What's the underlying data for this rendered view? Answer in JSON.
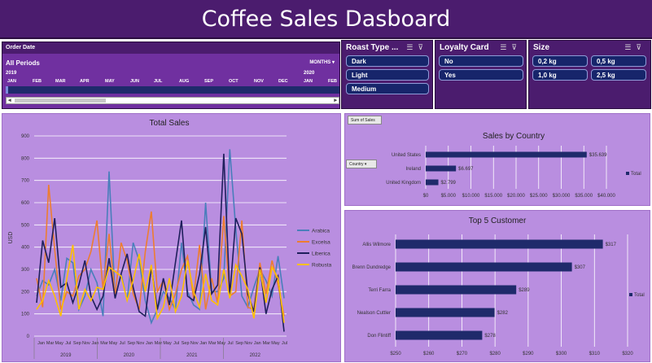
{
  "dashboard": {
    "title": "Coffee Sales Dasboard"
  },
  "timeline": {
    "header": "Order Date",
    "period": "All Periods",
    "granularity": "MONTHS",
    "years": [
      "2019",
      "2020"
    ],
    "months": [
      "JAN",
      "FEB",
      "MAR",
      "APR",
      "MAY",
      "JUN",
      "JUL",
      "AUG",
      "SEP",
      "OCT",
      "NOV",
      "DEC",
      "JAN",
      "FEB"
    ]
  },
  "slicers": {
    "roast": {
      "title": "Roast Type ...",
      "items": [
        "Dark",
        "Light",
        "Medium"
      ]
    },
    "loyalty": {
      "title": "Loyalty Card",
      "items": [
        "No",
        "Yes"
      ]
    },
    "size": {
      "title": "Size",
      "items": [
        "0,2 kg",
        "0,5 kg",
        "1,0 kg",
        "2,5 kg"
      ]
    }
  },
  "icons": {
    "multi_select": "multi-select-icon",
    "clear_filter": "clear-filter-icon"
  },
  "colors": {
    "title_bar": "#4b1c6e",
    "panel": "#b98ee0",
    "bar": "#17256b",
    "arabica": "#4a7ebb",
    "excelsa": "#ed7d31",
    "liberica": "#1f1f5c",
    "robusta": "#ffc000"
  },
  "pivot_buttons": {
    "sum_of_sales": "Sum of Sales",
    "country_field": "Country"
  },
  "chart_data": [
    {
      "type": "line",
      "title": "Total Sales",
      "ylabel": "USD",
      "ylim": [
        0,
        900
      ],
      "yticks": [
        0,
        100,
        200,
        300,
        400,
        500,
        600,
        700,
        800,
        900
      ],
      "x_month_labels": [
        "Jan",
        "Mar",
        "May",
        "Jul",
        "Sep",
        "Nov"
      ],
      "x_year_labels": [
        "2019",
        "2020",
        "2021",
        "2022"
      ],
      "grid": true,
      "legend_position": "right",
      "series": [
        {
          "name": "Arabica",
          "color": "#4a7ebb",
          "values": [
            180,
            250,
            230,
            300,
            160,
            350,
            330,
            120,
            180,
            300,
            240,
            90,
            740,
            170,
            280,
            160,
            420,
            340,
            160,
            60,
            120,
            200,
            170,
            120,
            420,
            200,
            140,
            120,
            600,
            200,
            200,
            260,
            840,
            480,
            180,
            130,
            220,
            300,
            250,
            180,
            360,
            170
          ]
        },
        {
          "name": "Excelsa",
          "color": "#ed7d31",
          "values": [
            260,
            130,
            680,
            390,
            120,
            200,
            180,
            270,
            300,
            380,
            520,
            210,
            460,
            180,
            420,
            340,
            190,
            120,
            380,
            560,
            200,
            250,
            120,
            190,
            300,
            360,
            170,
            410,
            120,
            260,
            150,
            540,
            180,
            200,
            520,
            130,
            120,
            330,
            190,
            340,
            230,
            90
          ]
        },
        {
          "name": "Liberica",
          "color": "#1f1f5c",
          "values": [
            150,
            430,
            330,
            530,
            220,
            240,
            150,
            230,
            340,
            180,
            120,
            180,
            350,
            170,
            280,
            370,
            220,
            110,
            90,
            310,
            120,
            260,
            140,
            330,
            520,
            180,
            160,
            280,
            490,
            190,
            230,
            820,
            180,
            530,
            460,
            190,
            110,
            310,
            100,
            210,
            270,
            20
          ]
        },
        {
          "name": "Robusta",
          "color": "#ffc000",
          "values": [
            120,
            160,
            250,
            180,
            90,
            260,
            410,
            120,
            210,
            160,
            220,
            210,
            310,
            290,
            270,
            160,
            250,
            370,
            200,
            320,
            80,
            130,
            260,
            110,
            180,
            340,
            200,
            130,
            280,
            160,
            140,
            300,
            170,
            320,
            270,
            210,
            80,
            300,
            150,
            310,
            260,
            60
          ]
        }
      ]
    },
    {
      "type": "bar",
      "title": "Sales by Country",
      "categories": [
        "United States",
        "Ireland",
        "United Kingdom"
      ],
      "values": [
        35639,
        6697,
        2799
      ],
      "value_labels": [
        "$35.639",
        "$6.697",
        "$2.799"
      ],
      "xticks": [
        "$0",
        "$5.000",
        "$10.000",
        "$15.000",
        "$20.000",
        "$25.000",
        "$30.000",
        "$35.000",
        "$40.000"
      ],
      "xlim": [
        0,
        40000
      ],
      "legend": "Total",
      "legend_position": "right"
    },
    {
      "type": "bar",
      "title": "Top 5 Customer",
      "categories": [
        "Allis Wilmore",
        "Brenn Dundredge",
        "Terri Farra",
        "Nealson Cuttler",
        "Don Flintiff"
      ],
      "values": [
        317,
        307,
        289,
        282,
        278
      ],
      "value_labels": [
        "$317",
        "$307",
        "$289",
        "$282",
        "$278"
      ],
      "xticks": [
        "$250",
        "$260",
        "$270",
        "$280",
        "$290",
        "$300",
        "$310",
        "$320"
      ],
      "xlim": [
        250,
        325
      ],
      "legend": "Total",
      "legend_position": "right"
    }
  ]
}
